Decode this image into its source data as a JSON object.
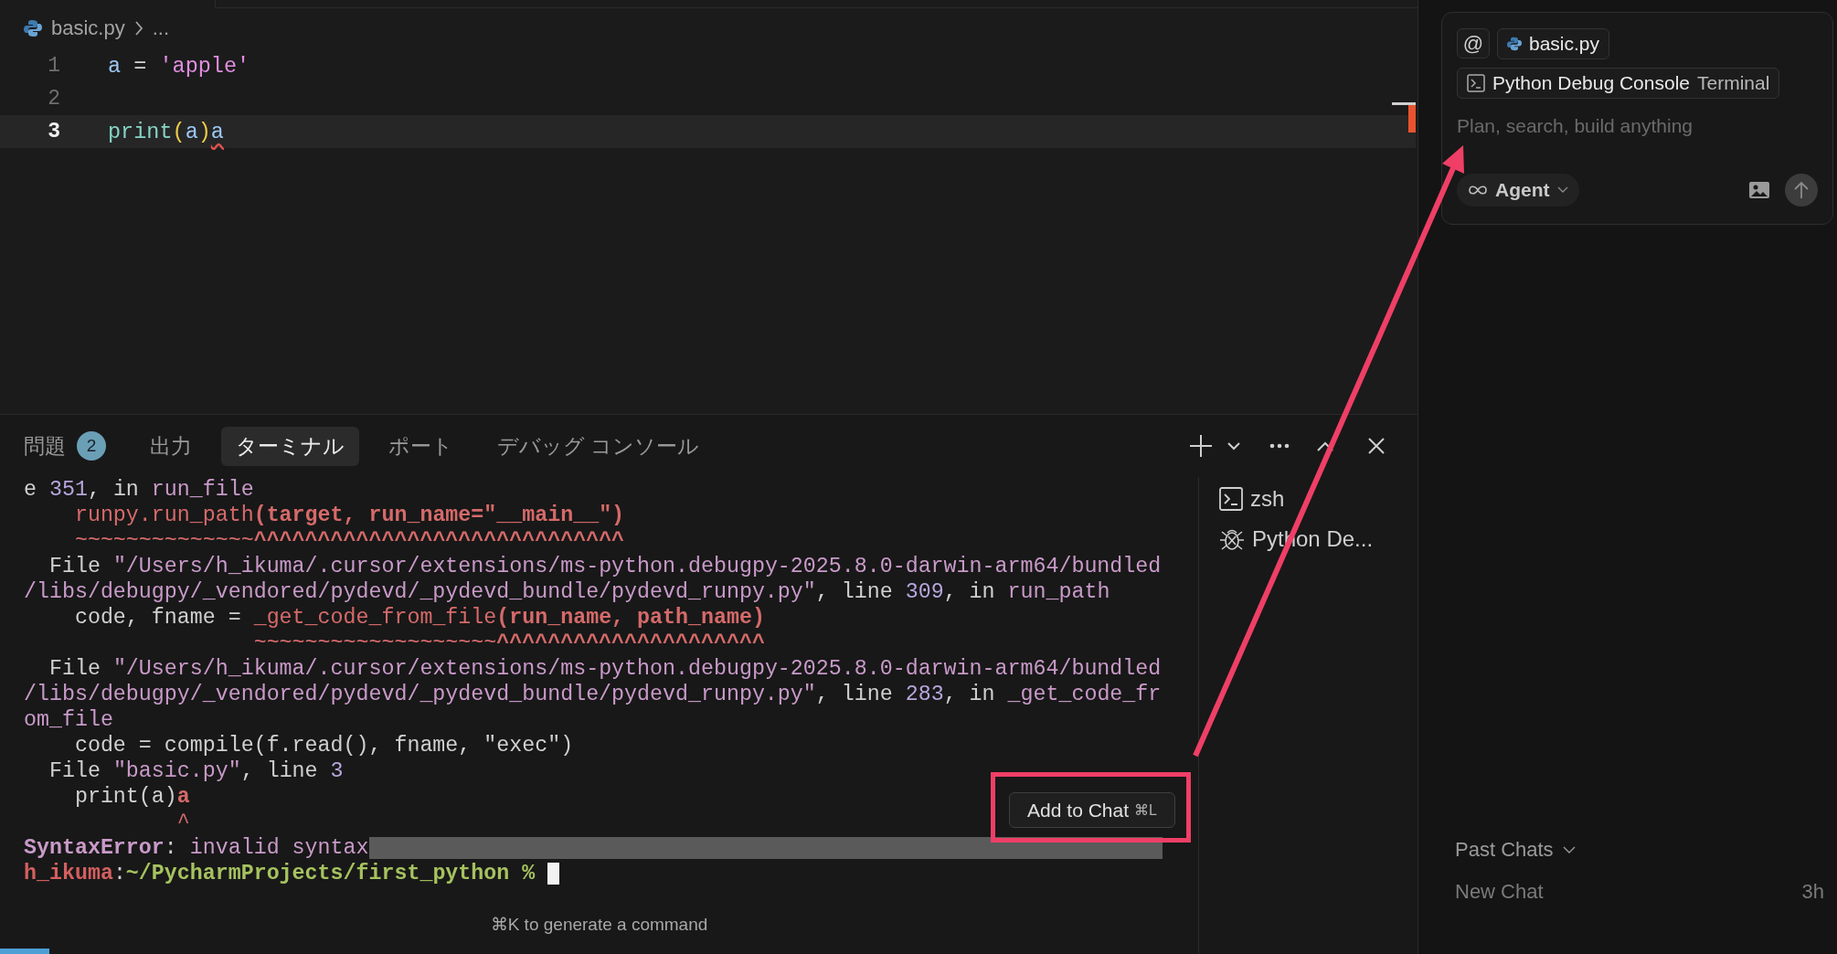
{
  "breadcrumb": {
    "file": "basic.py",
    "more": "..."
  },
  "editor": {
    "lines": [
      {
        "number": "1",
        "current": false,
        "tokens": [
          {
            "text": "a",
            "kind": "variable"
          },
          {
            "text": " = ",
            "kind": "operator"
          },
          {
            "text": "'apple'",
            "kind": "string"
          }
        ]
      },
      {
        "number": "2",
        "current": false
      },
      {
        "number": "3",
        "current": true,
        "tokens": [
          {
            "text": "print",
            "kind": "function"
          },
          {
            "text": "(",
            "kind": "bracket"
          },
          {
            "text": "a",
            "kind": "variable"
          },
          {
            "text": ")",
            "kind": "bracket"
          },
          {
            "text": "a",
            "kind": "error"
          }
        ]
      }
    ]
  },
  "panel": {
    "tabs": [
      {
        "label": "問題",
        "badge": "2",
        "selected": false
      },
      {
        "label": "出力",
        "selected": false
      },
      {
        "label": "ターミナル",
        "selected": true
      },
      {
        "label": "ポート",
        "selected": false
      },
      {
        "label": "デバッグ コンソール",
        "selected": false
      }
    ],
    "terminal": {
      "cursor": true,
      "lines": [
        {
          "selected": false,
          "segments": [
            {
              "text": "e ",
              "kind": "plain"
            },
            {
              "text": "351",
              "kind": "number"
            },
            {
              "text": ", in ",
              "kind": "plain"
            },
            {
              "text": "run_file",
              "kind": "string"
            }
          ]
        },
        {
          "selected": false,
          "segments": [
            {
              "text": "    runpy.run_path",
              "kind": "error"
            },
            {
              "text": "(target, run_name=\"__main__\")",
              "kind": "error_bold"
            }
          ]
        },
        {
          "selected": false,
          "segments": [
            {
              "text": "    ~~~~~~~~~~~~~~",
              "kind": "error"
            },
            {
              "text": "^^^^^^^^^^^^^^^^^^^^^^^^^^^^^",
              "kind": "error_bold"
            }
          ]
        },
        {
          "selected": false,
          "segments": [
            {
              "text": "  File ",
              "kind": "plain"
            },
            {
              "text": "\"/Users/h_ikuma/.cursor/extensions/ms-python.debugpy-2025.8.0-darwin-arm64/bundled",
              "kind": "string"
            }
          ]
        },
        {
          "selected": false,
          "segments": [
            {
              "text": "/libs/debugpy/_vendored/pydevd/_pydevd_bundle/pydevd_runpy.py\"",
              "kind": "string"
            },
            {
              "text": ", line ",
              "kind": "plain"
            },
            {
              "text": "309",
              "kind": "number"
            },
            {
              "text": ", in ",
              "kind": "plain"
            },
            {
              "text": "run_path",
              "kind": "string"
            }
          ]
        },
        {
          "selected": false,
          "segments": [
            {
              "text": "    code, fname = ",
              "kind": "plain"
            },
            {
              "text": "_get_code_from_file",
              "kind": "error"
            },
            {
              "text": "(run_name, path_name)",
              "kind": "error_bold"
            }
          ]
        },
        {
          "selected": false,
          "segments": [
            {
              "text": "                  ~~~~~~~~~~~~~~~~~~~",
              "kind": "error"
            },
            {
              "text": "^^^^^^^^^^^^^^^^^^^^^",
              "kind": "error_bold"
            }
          ]
        },
        {
          "selected": false,
          "segments": [
            {
              "text": "  File ",
              "kind": "plain"
            },
            {
              "text": "\"/Users/h_ikuma/.cursor/extensions/ms-python.debugpy-2025.8.0-darwin-arm64/bundled",
              "kind": "string"
            }
          ]
        },
        {
          "selected": false,
          "segments": [
            {
              "text": "/libs/debugpy/_vendored/pydevd/_pydevd_bundle/pydevd_runpy.py\"",
              "kind": "string"
            },
            {
              "text": ", line ",
              "kind": "plain"
            },
            {
              "text": "283",
              "kind": "number"
            },
            {
              "text": ", in ",
              "kind": "plain"
            },
            {
              "text": "_get_code_fr",
              "kind": "string"
            }
          ]
        },
        {
          "selected": false,
          "segments": [
            {
              "text": "om_file",
              "kind": "string"
            }
          ]
        },
        {
          "selected": false,
          "segments": [
            {
              "text": "    code = compile(f.read(), fname, \"exec\")",
              "kind": "plain"
            }
          ]
        },
        {
          "selected": false,
          "segments": [
            {
              "text": "  File ",
              "kind": "plain"
            },
            {
              "text": "\"basic.py\"",
              "kind": "string"
            },
            {
              "text": ", line ",
              "kind": "plain"
            },
            {
              "text": "3",
              "kind": "number"
            }
          ]
        },
        {
          "selected": false,
          "segments": [
            {
              "text": "    print(a)",
              "kind": "plain"
            },
            {
              "text": "a",
              "kind": "error_bold"
            }
          ]
        },
        {
          "selected": false,
          "segments": [
            {
              "text": "            ^",
              "kind": "error"
            }
          ]
        },
        {
          "selected": true,
          "segments": [
            {
              "text": "SyntaxError",
              "kind": "error_name"
            },
            {
              "text": ": ",
              "kind": "plain"
            },
            {
              "text": "invalid syntax",
              "kind": "string"
            }
          ]
        },
        {
          "selected": false,
          "segments": [
            {
              "text": "h_ikuma",
              "kind": "prompt_user"
            },
            {
              "text": ":",
              "kind": "plain"
            },
            {
              "text": "~/PycharmProjects/first_python %",
              "kind": "prompt_path"
            }
          ]
        }
      ]
    },
    "add_to_chat": {
      "label": "Add to Chat",
      "shortcut": "⌘L"
    },
    "hint": "⌘K to generate a command",
    "terminals": [
      {
        "label": "zsh",
        "kind": "shell"
      },
      {
        "label": "Python De...",
        "kind": "debug"
      }
    ]
  },
  "chat": {
    "mention": "@",
    "context": [
      {
        "kind": "file",
        "label": "basic.py"
      },
      {
        "kind": "terminal",
        "label": "Python Debug Console",
        "detail": "Terminal"
      }
    ],
    "placeholder": "Plan, search, build anything",
    "mode": "Agent",
    "past_chats": {
      "title": "Past Chats",
      "items": [
        {
          "title": "New Chat",
          "time": "3h"
        }
      ]
    }
  }
}
